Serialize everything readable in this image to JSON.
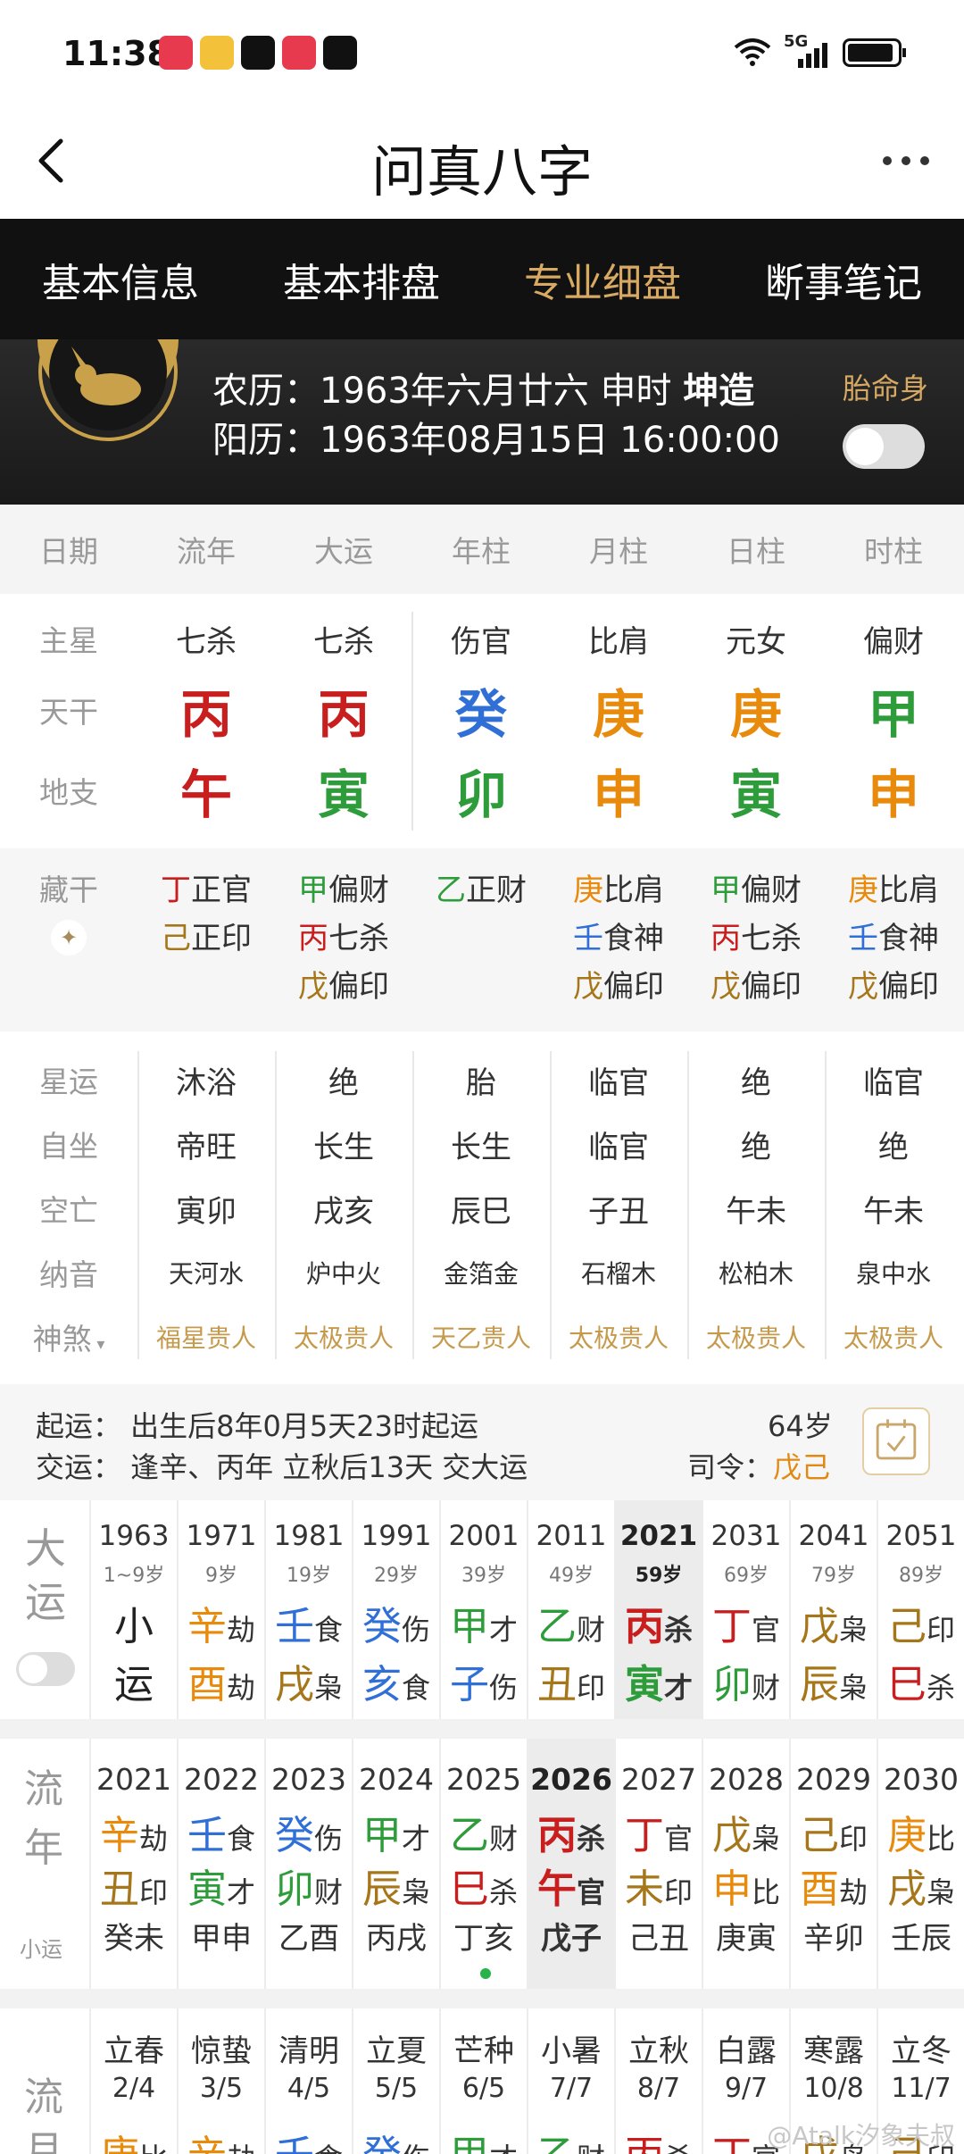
{
  "status_bar": {
    "time": "11:38",
    "network": "5G"
  },
  "title_bar": {
    "title": "问真八字"
  },
  "tabs": [
    {
      "label": "基本信息"
    },
    {
      "label": "基本排盘"
    },
    {
      "label": "专业细盘"
    },
    {
      "label": "断事笔记"
    }
  ],
  "profile": {
    "lunar_label": "农历：1963年六月廿六 申时",
    "gender_label": "坤造",
    "solar_label": "阳历：1963年08月15日 16:00:00",
    "tms_label": "胎命身"
  },
  "columns": [
    "日期",
    "流年",
    "大运",
    "年柱",
    "月柱",
    "日柱",
    "时柱"
  ],
  "main_stars": {
    "label": "主星",
    "values": [
      "七杀",
      "七杀",
      "伤官",
      "比肩",
      "元女",
      "偏财"
    ]
  },
  "tiangan": {
    "label": "天干",
    "values": [
      "丙",
      "丙",
      "癸",
      "庚",
      "庚",
      "甲"
    ]
  },
  "dizhi": {
    "label": "地支",
    "values": [
      "午",
      "寅",
      "卯",
      "申",
      "寅",
      "申"
    ]
  },
  "canggan": {
    "label": "藏干",
    "cols": [
      [
        {
          "g": "丁",
          "s": "正官"
        },
        {
          "g": "己",
          "s": "正印"
        }
      ],
      [
        {
          "g": "甲",
          "s": "偏财"
        },
        {
          "g": "丙",
          "s": "七杀"
        },
        {
          "g": "戊",
          "s": "偏印"
        }
      ],
      [
        {
          "g": "乙",
          "s": "正财"
        }
      ],
      [
        {
          "g": "庚",
          "s": "比肩"
        },
        {
          "g": "壬",
          "s": "食神"
        },
        {
          "g": "戊",
          "s": "偏印"
        }
      ],
      [
        {
          "g": "甲",
          "s": "偏财"
        },
        {
          "g": "丙",
          "s": "七杀"
        },
        {
          "g": "戊",
          "s": "偏印"
        }
      ],
      [
        {
          "g": "庚",
          "s": "比肩"
        },
        {
          "g": "壬",
          "s": "食神"
        },
        {
          "g": "戊",
          "s": "偏印"
        }
      ]
    ]
  },
  "xingyun": {
    "label": "星运",
    "values": [
      "沐浴",
      "绝",
      "胎",
      "临官",
      "绝",
      "临官"
    ]
  },
  "zizuo": {
    "label": "自坐",
    "values": [
      "帝旺",
      "长生",
      "长生",
      "临官",
      "绝",
      "绝"
    ]
  },
  "kongwang": {
    "label": "空亡",
    "values": [
      "寅卯",
      "戌亥",
      "辰巳",
      "子丑",
      "午未",
      "午未"
    ]
  },
  "nayin": {
    "label": "纳音",
    "values": [
      "天河水",
      "炉中火",
      "金箔金",
      "石榴木",
      "松柏木",
      "泉中水"
    ]
  },
  "shensha": {
    "label": "神煞",
    "values": [
      "福星贵人",
      "太极贵人",
      "天乙贵人",
      "太极贵人",
      "太极贵人",
      "太极贵人"
    ]
  },
  "qiyun": {
    "line1": "起运：  出生后8年0月5天23时起运",
    "line2": "交运：  逢辛、丙年 立秋后13天 交大运",
    "age": "64岁",
    "siling_label": "司令：",
    "siling_value": "戊己"
  },
  "dayun": {
    "label": "大运",
    "cells": [
      {
        "year": "1963",
        "age": "1~9岁",
        "top": "小",
        "bottom": "运"
      },
      {
        "year": "1971",
        "age": "9岁",
        "g1": "辛",
        "s1": "劫",
        "g2": "酉",
        "s2": "劫"
      },
      {
        "year": "1981",
        "age": "19岁",
        "g1": "壬",
        "s1": "食",
        "g2": "戌",
        "s2": "枭"
      },
      {
        "year": "1991",
        "age": "29岁",
        "g1": "癸",
        "s1": "伤",
        "g2": "亥",
        "s2": "食"
      },
      {
        "year": "2001",
        "age": "39岁",
        "g1": "甲",
        "s1": "才",
        "g2": "子",
        "s2": "伤"
      },
      {
        "year": "2011",
        "age": "49岁",
        "g1": "乙",
        "s1": "财",
        "g2": "丑",
        "s2": "印"
      },
      {
        "year": "2021",
        "age": "59岁",
        "g1": "丙",
        "s1": "杀",
        "g2": "寅",
        "s2": "才"
      },
      {
        "year": "2031",
        "age": "69岁",
        "g1": "丁",
        "s1": "官",
        "g2": "卯",
        "s2": "财"
      },
      {
        "year": "2041",
        "age": "79岁",
        "g1": "戊",
        "s1": "枭",
        "g2": "辰",
        "s2": "枭"
      },
      {
        "year": "2051",
        "age": "89岁",
        "g1": "己",
        "s1": "印",
        "g2": "巳",
        "s2": "杀"
      }
    ]
  },
  "liunian": {
    "label": "流年",
    "sub_label": "小运",
    "cells": [
      {
        "year": "2021",
        "g1": "辛",
        "s1": "劫",
        "g2": "丑",
        "s2": "印",
        "gz": "癸未"
      },
      {
        "year": "2022",
        "g1": "壬",
        "s1": "食",
        "g2": "寅",
        "s2": "才",
        "gz": "甲申"
      },
      {
        "year": "2023",
        "g1": "癸",
        "s1": "伤",
        "g2": "卯",
        "s2": "财",
        "gz": "乙酉"
      },
      {
        "year": "2024",
        "g1": "甲",
        "s1": "才",
        "g2": "辰",
        "s2": "枭",
        "gz": "丙戌"
      },
      {
        "year": "2025",
        "g1": "乙",
        "s1": "财",
        "g2": "巳",
        "s2": "杀",
        "gz": "丁亥"
      },
      {
        "year": "2026",
        "g1": "丙",
        "s1": "杀",
        "g2": "午",
        "s2": "官",
        "gz": "戊子"
      },
      {
        "year": "2027",
        "g1": "丁",
        "s1": "官",
        "g2": "未",
        "s2": "印",
        "gz": "己丑"
      },
      {
        "year": "2028",
        "g1": "戊",
        "s1": "枭",
        "g2": "申",
        "s2": "比",
        "gz": "庚寅"
      },
      {
        "year": "2029",
        "g1": "己",
        "s1": "印",
        "g2": "酉",
        "s2": "劫",
        "gz": "辛卯"
      },
      {
        "year": "2030",
        "g1": "庚",
        "s1": "比",
        "g2": "戌",
        "s2": "枭",
        "gz": "壬辰"
      }
    ]
  },
  "liuyue": {
    "label": "流月",
    "cells": [
      {
        "term": "立春",
        "date": "2/4",
        "g1": "庚",
        "s1": "比"
      },
      {
        "term": "惊蛰",
        "date": "3/5",
        "g1": "辛",
        "s1": "劫"
      },
      {
        "term": "清明",
        "date": "4/5",
        "g1": "壬",
        "s1": "食"
      },
      {
        "term": "立夏",
        "date": "5/5",
        "g1": "癸",
        "s1": "伤"
      },
      {
        "term": "芒种",
        "date": "6/5",
        "g1": "甲",
        "s1": "才"
      },
      {
        "term": "小暑",
        "date": "7/7",
        "g1": "乙",
        "s1": "财"
      },
      {
        "term": "立秋",
        "date": "8/7",
        "g1": "丙",
        "s1": "杀"
      },
      {
        "term": "白露",
        "date": "9/7",
        "g1": "丁",
        "s1": "官"
      },
      {
        "term": "寒露",
        "date": "10/8",
        "g1": "戊",
        "s1": "枭"
      },
      {
        "term": "立冬",
        "date": "11/7",
        "g1": "己",
        "s1": "印"
      }
    ]
  },
  "watermark": "@Atalk汐象夫叔",
  "colors": {
    "wood": "#2e9c3a",
    "fire": "#c81e1e",
    "earth": "#a6761a",
    "metal": "#e88a0c",
    "water": "#2f6fd6",
    "accent": "#d7a962"
  }
}
